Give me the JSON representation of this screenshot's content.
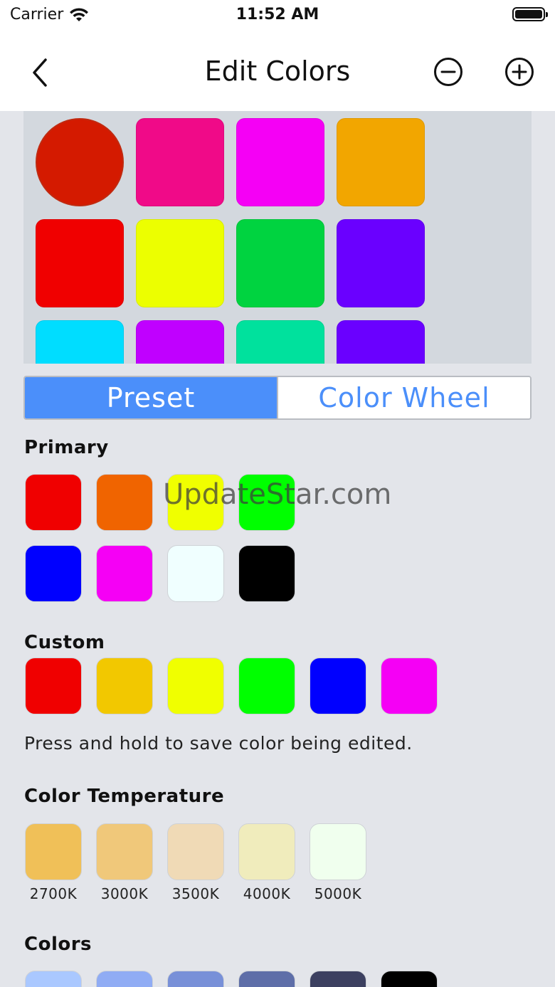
{
  "status_bar": {
    "carrier": "Carrier",
    "time": "11:52 AM"
  },
  "nav": {
    "title": "Edit Colors"
  },
  "grid": {
    "rows": [
      [
        "#d41a00",
        "#f00a88",
        "#f500f5",
        "#f2a600"
      ],
      [
        "#f00000",
        "#ecff00",
        "#00d340",
        "#6a00ff"
      ],
      [
        "#00ddff",
        "#c000ff",
        "#00e19d",
        "#6a00ff"
      ]
    ]
  },
  "segmented": {
    "preset": "Preset",
    "color_wheel": "Color Wheel"
  },
  "sections": {
    "primary": "Primary",
    "custom": "Custom",
    "hint": "Press and hold to save color being edited.",
    "temperature": "Color Temperature",
    "colors": "Colors"
  },
  "primary_colors": [
    [
      "#f00000",
      "#f06400",
      "#f0ff00",
      "#00ff00"
    ],
    [
      "#0000ff",
      "#f500f5",
      "#f0ffff",
      "#000000"
    ]
  ],
  "custom_colors": [
    "#f00000",
    "#f2c800",
    "#f0ff00",
    "#00ff00",
    "#0000ff",
    "#f500f5"
  ],
  "temperatures": [
    {
      "label": "2700K",
      "color": "#f0c058"
    },
    {
      "label": "3000K",
      "color": "#f0c87a"
    },
    {
      "label": "3500K",
      "color": "#f0dab6"
    },
    {
      "label": "4000K",
      "color": "#f0ecbc"
    },
    {
      "label": "5000K",
      "color": "#f0ffee"
    }
  ],
  "bottom_colors": [
    "#aac8ff",
    "#90acf4",
    "#7890d8",
    "#5e6ea8",
    "#3c4060",
    "#000000"
  ],
  "watermark": "UpdateStar.com"
}
